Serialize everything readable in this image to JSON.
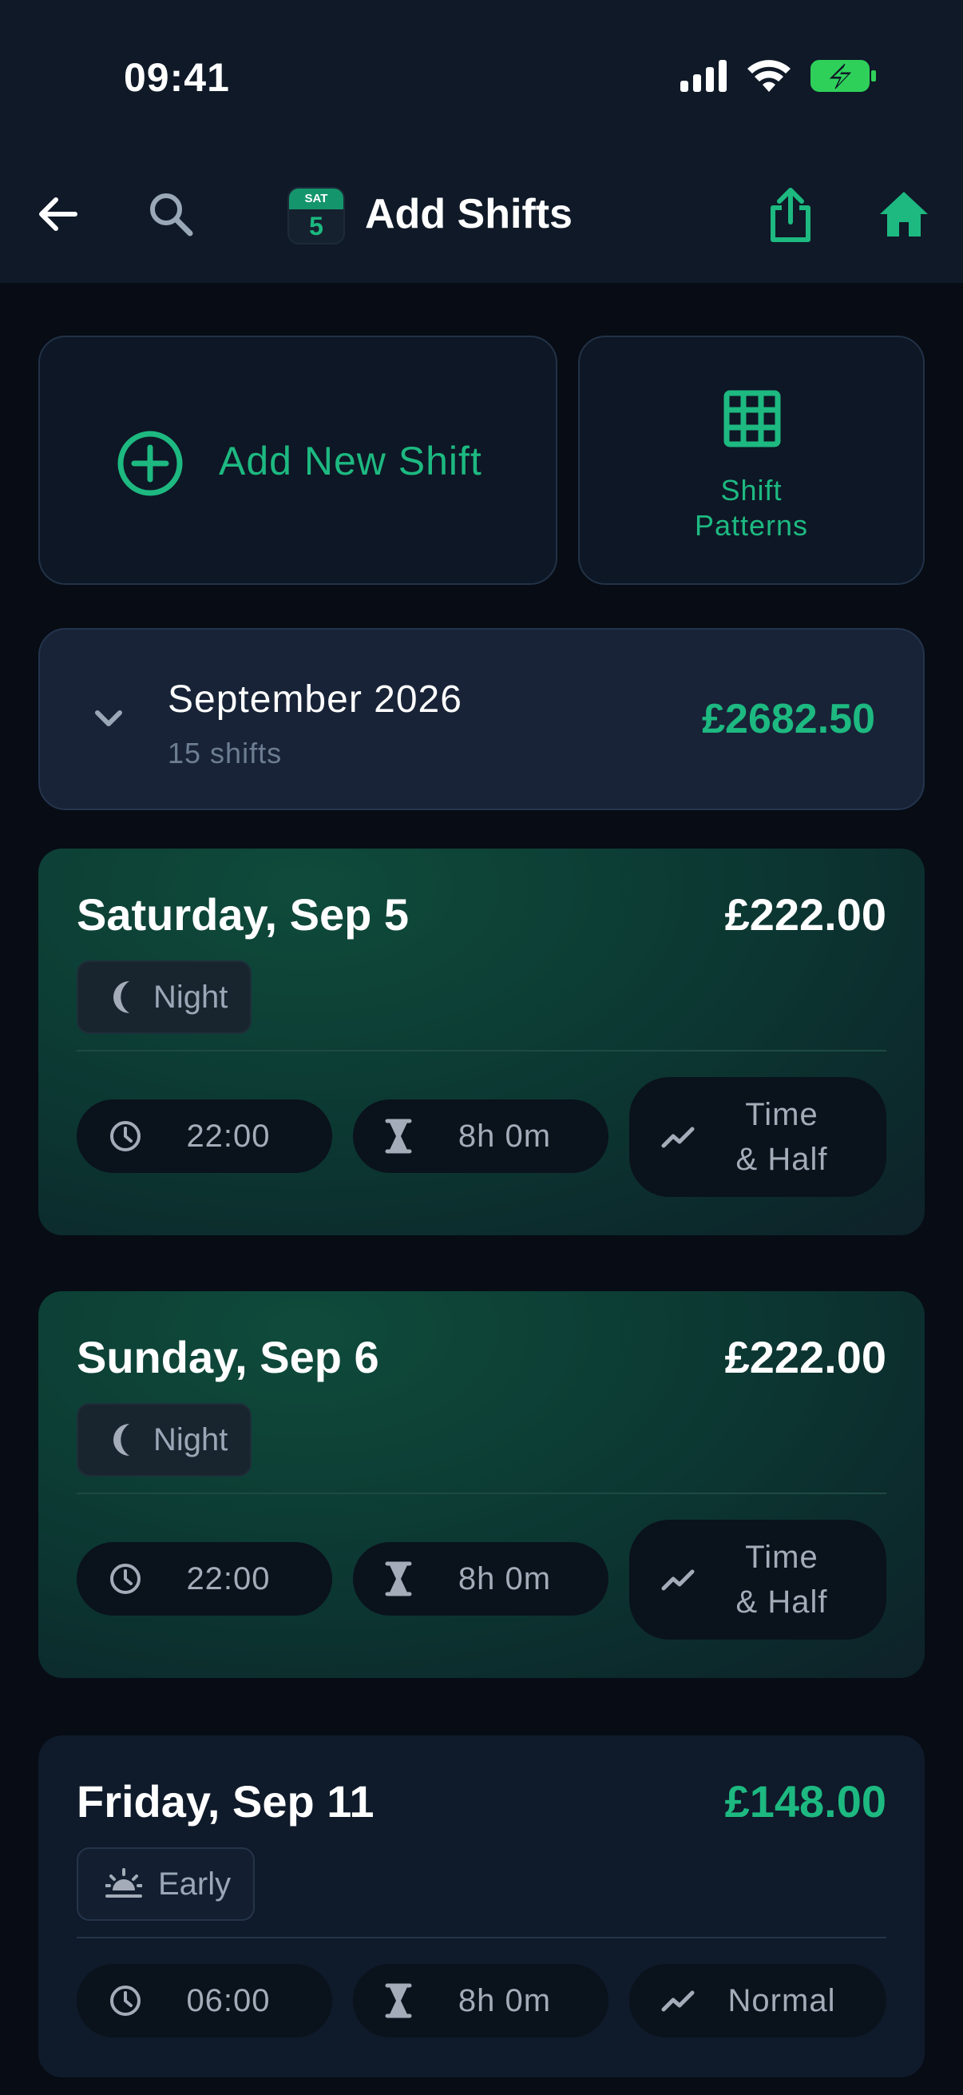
{
  "status_bar": {
    "time": "09:41"
  },
  "nav": {
    "title": "Add Shifts",
    "calendar_icon": {
      "weekday": "SAT",
      "day": "5"
    }
  },
  "actions": {
    "add_shift_label": "Add New Shift",
    "patterns_label": "Shift\nPatterns"
  },
  "month": {
    "name": "September 2026",
    "count": "15 shifts",
    "total": "£2682.50"
  },
  "shifts": [
    {
      "date": "Saturday, Sep 5",
      "pay": "£222.00",
      "type": "Night",
      "start": "22:00",
      "duration": "8h 0m",
      "rate": "Time\n& Half"
    },
    {
      "date": "Sunday, Sep 6",
      "pay": "£222.00",
      "type": "Night",
      "start": "22:00",
      "duration": "8h 0m",
      "rate": "Time\n& Half"
    },
    {
      "date": "Friday, Sep 11",
      "pay": "£148.00",
      "type": "Early",
      "start": "06:00",
      "duration": "8h 0m",
      "rate": "Normal"
    }
  ],
  "colors": {
    "accent": "#1db981",
    "background": "#070c15",
    "header": "#0f1927"
  },
  "icons": [
    "back-arrow-icon",
    "search-icon",
    "calendar-icon",
    "share-icon",
    "home-icon",
    "plus-circle-icon",
    "grid-icon",
    "chevron-down-icon",
    "moon-icon",
    "sunrise-icon",
    "clock-icon",
    "hourglass-icon",
    "trend-icon"
  ]
}
